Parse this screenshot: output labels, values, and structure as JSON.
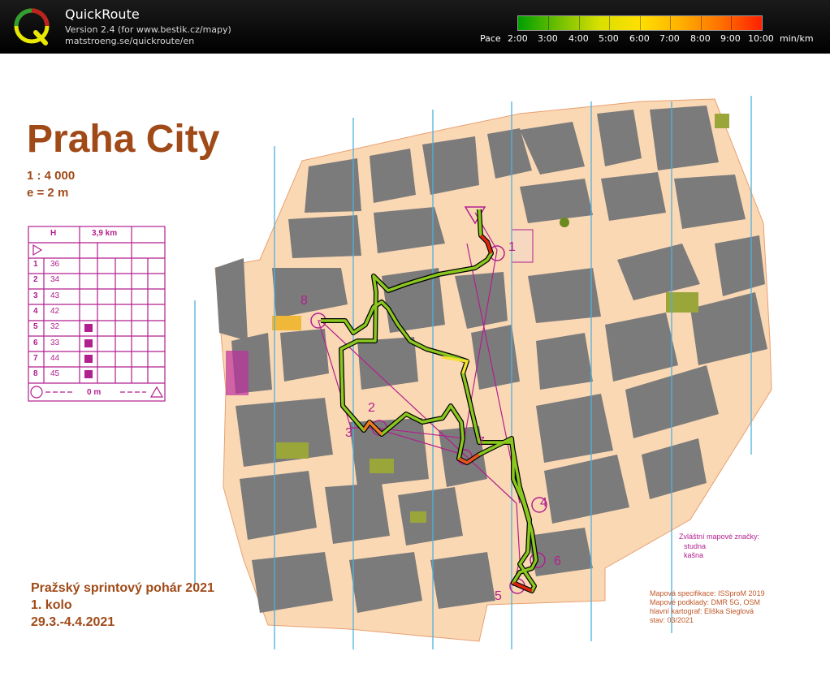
{
  "app": {
    "title": "QuickRoute",
    "version_line": "Version 2.4  (for www.bestik.cz/mapy)",
    "url_line": "matstroeng.se/quickroute/en",
    "logo_letter": "Q"
  },
  "pace_scale": {
    "prefix": "Pace",
    "labels": [
      "2:00",
      "3:00",
      "4:00",
      "5:00",
      "6:00",
      "7:00",
      "8:00",
      "9:00",
      "10:00"
    ],
    "unit": "min/km"
  },
  "map": {
    "title": "Praha City",
    "scale": "1 : 4 000",
    "equidistance": "e = 2 m",
    "description_sheet": {
      "header": [
        "H",
        "3,9 km"
      ],
      "start_symbol": "▷",
      "controls": [
        {
          "num": "1",
          "code": "36"
        },
        {
          "num": "2",
          "code": "34"
        },
        {
          "num": "3",
          "code": "43"
        },
        {
          "num": "4",
          "code": "42"
        },
        {
          "num": "5",
          "code": "32"
        },
        {
          "num": "6",
          "code": "33"
        },
        {
          "num": "7",
          "code": "44"
        },
        {
          "num": "8",
          "code": "45"
        }
      ],
      "finish_distance": "0 m"
    },
    "event": {
      "name": "Pražský sprintový pohár 2021",
      "round": "1. kolo",
      "dates": "29.3.-4.4.2021"
    },
    "legend": {
      "title": "Zvláštní mapové značky:",
      "items": [
        "studna",
        "kašna"
      ]
    },
    "credits": [
      "Mapová specifikace: ISSproM 2019",
      "Mapové podklady: DMR 5G, OSM",
      "hlavní kartograf: Eliška Sieglová",
      "stav: 03/2021"
    ],
    "control_labels": [
      "1",
      "2",
      "3",
      "4",
      "5",
      "6",
      "7",
      "8"
    ],
    "colors": {
      "map_background": "#fbd8b4",
      "buildings": "#7b7b7b",
      "overprint": "#b21f8f",
      "text": "#a04a18"
    }
  }
}
